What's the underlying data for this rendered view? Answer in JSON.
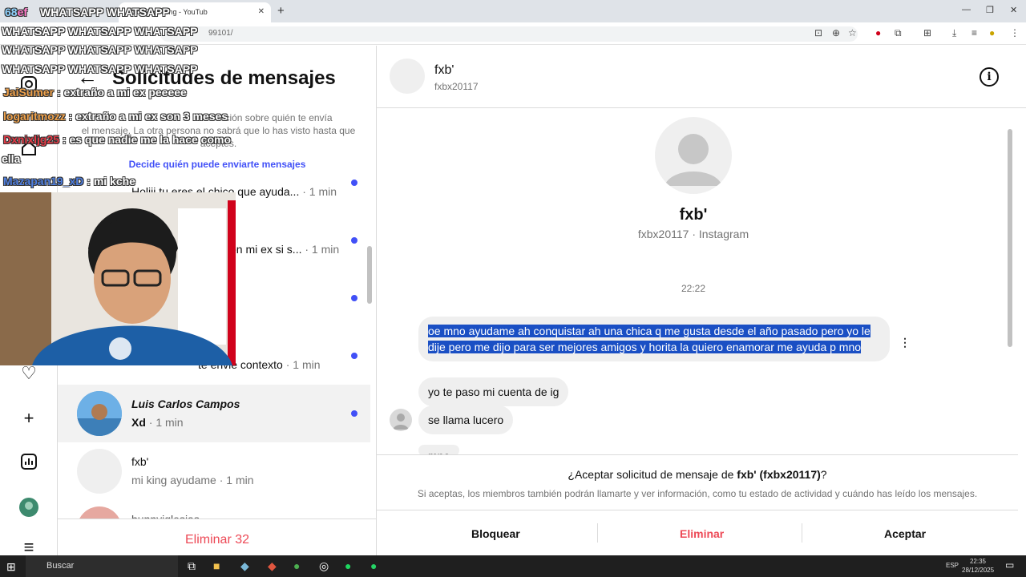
{
  "browser": {
    "tab_title": "nd of Beginning - YouTub",
    "url_fragment": "99101/",
    "new_tab": "+",
    "minimize": "—",
    "restore": "❐",
    "close": "✕"
  },
  "overlay": {
    "counter_prefix": "68",
    "counter_suffix": "ef",
    "banner_lines": [
      "WHATSAPP WHATSAPP",
      "WHATSAPP WHATSAPP WHATSAPP",
      "WHATSAPP WHATSAPP WHATSAPP",
      "WHATSAPP WHATSAPP WHATSAPP"
    ],
    "chat": [
      {
        "user": "JaiSumer",
        "text": ": extraño a mi ex peeeee",
        "color": "#f0a24b"
      },
      {
        "user": "logaritmozz",
        "text": ": extraño a mi ex son 3 meses",
        "color": "#f0a24b"
      },
      {
        "user": "Dxnixljg25",
        "text": ": es que nadie me la hace como",
        "color": "#e43b47"
      },
      {
        "user": "",
        "text": "ella",
        "color": "#ffffff"
      },
      {
        "user": "Mazapan19_xD",
        "text": ": mi kche",
        "color": "#4f7fe0"
      }
    ]
  },
  "requests": {
    "title": "Solicitudes de mensajes",
    "info": "Abre un chat para obtener información sobre quién te envía el mensaje. La otra persona no sabrá que lo has visto hasta que aceptes.",
    "info_visible_1": "ción sobre quién te envía",
    "info_visible_2": "el mensaje. La otra persona no sabrá que lo has visto hasta que",
    "info_visible_3": "aceptes.",
    "who_link": "Decide quién puede enviarte mensajes",
    "rows": [
      {
        "name": "",
        "snippet": "Holiii tu eres el chico que ayuda...",
        "time": "· 1 min",
        "unread": true
      },
      {
        "name": "",
        "snippet": "on mi ex si s...",
        "time": "· 1 min",
        "unread": true
      },
      {
        "name": "",
        "snippet": "",
        "time": "",
        "unread": true
      },
      {
        "name": "",
        "snippet": "te envié contexto",
        "time": "· 1 min",
        "unread": true
      },
      {
        "name": "Luis Carlos Campos",
        "snippet": "Xd",
        "time": "· 1 min",
        "unread": true
      },
      {
        "name": "fxb'",
        "snippet": "mi king ayudame",
        "time": "· 1 min",
        "unread": false
      },
      {
        "name": "bunnyiglesias",
        "snippet": "",
        "time": "",
        "unread": false
      }
    ],
    "delete_label": "Eliminar 32"
  },
  "chat": {
    "name": "fxb'",
    "username": "fxbx20117",
    "profile_name": "fxb'",
    "profile_sub": "fxbx20117 · Instagram",
    "time": "22:22",
    "messages": [
      "oe mno ayudame ah conquistar ah una chica q me gusta desde el año pasado pero yo le dije pero me dijo para ser  mejores amigos y horita la quiero enamorar me ayuda p mno",
      "yo te paso mi cuenta de ig",
      "se llama lucero",
      "mno"
    ],
    "accept_prefix": "¿Aceptar solicitud de mensaje de ",
    "accept_name": "fxb' (fxbx20117)",
    "accept_suffix": "?",
    "accept_note": "Si aceptas, los miembros también podrán llamarte y ver información, como tu estado de actividad y cuándo has leído los mensajes.",
    "block_label": "Bloquear",
    "delete_label": "Eliminar",
    "accept_label": "Aceptar"
  },
  "taskbar": {
    "search_placeholder": "Buscar",
    "time": "22:35",
    "date": "28/12/2025",
    "lang": "ESP"
  },
  "colors": {
    "accent_blue": "#4150f7",
    "danger_red": "#ed4956",
    "selection": "#1a4fc4"
  }
}
